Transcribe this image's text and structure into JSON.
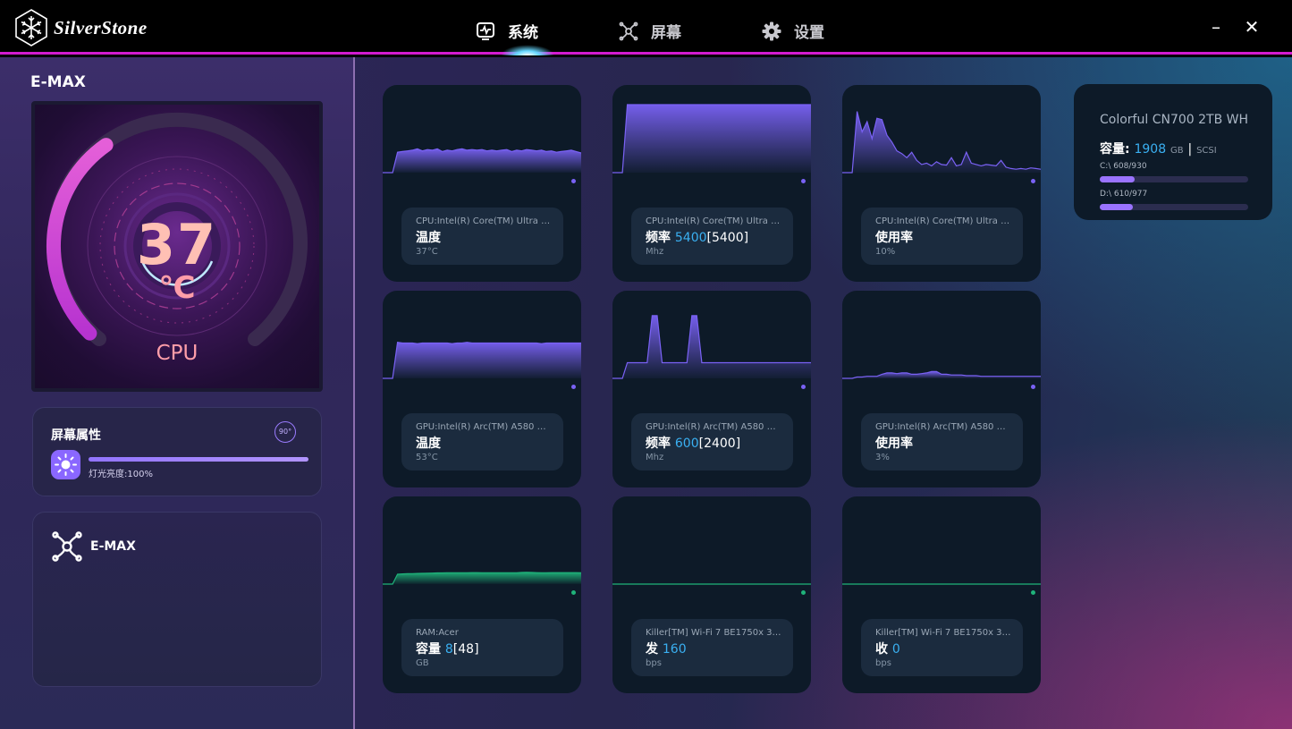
{
  "app": {
    "brand": "SilverStone",
    "nav": [
      {
        "label": "系统",
        "icon": "monitor-heart-icon",
        "active": true
      },
      {
        "label": "屏幕",
        "icon": "fan-icon",
        "active": false
      },
      {
        "label": "设置",
        "icon": "gear-icon",
        "active": false
      }
    ],
    "window_controls": {
      "minimize": "–",
      "close": "✕"
    }
  },
  "left": {
    "section_title": "E-MAX",
    "preview": {
      "temp_value": "37",
      "temp_unit": "℃",
      "label": "CPU",
      "gauge_fraction": 0.37
    },
    "screen_props": {
      "title": "屏幕属性",
      "rotate_label": "90°",
      "brightness_text": "灯光亮度:100%",
      "brightness_value": 1.0
    },
    "device": {
      "name": "E-MAX"
    }
  },
  "cards": [
    {
      "source": "CPU:Intel(R) Core(TM) Ultra 7…",
      "metric": "温度",
      "current": "",
      "max": "",
      "sub": "37°C",
      "series": [
        0,
        0,
        0,
        30,
        31,
        32,
        33,
        35,
        32,
        34,
        33,
        35,
        31,
        33,
        32,
        34,
        35,
        33,
        34,
        33,
        34,
        32,
        33,
        32,
        33,
        34,
        31,
        33,
        32,
        34,
        33,
        32,
        33,
        31,
        32,
        30,
        31,
        32,
        33,
        31,
        29
      ],
      "ymax": 100,
      "color": "purple"
    },
    {
      "source": "CPU:Intel(R) Core(TM) Ultra 7…",
      "metric": "频率",
      "current": "5400",
      "max": "[5400]",
      "sub": "Mhz",
      "series": [
        0,
        0,
        0,
        5400,
        5400,
        5400,
        5400,
        5400,
        5400,
        5400,
        5400,
        5400,
        5400,
        5400,
        5400,
        5400,
        5400,
        5400,
        5400,
        5400,
        5400,
        5400,
        5400,
        5400,
        5400,
        5400,
        5400,
        5400,
        5400,
        5400,
        5400,
        5400,
        5400,
        5400,
        5400,
        5400,
        5400,
        5400,
        5400,
        5400,
        5400
      ],
      "ymax": 5400,
      "color": "purple"
    },
    {
      "source": "CPU:Intel(R) Core(TM) Ultra 7…",
      "metric": "使用率",
      "current": "",
      "max": "",
      "sub": "10%",
      "series": [
        0,
        0,
        0,
        90,
        60,
        75,
        50,
        80,
        78,
        55,
        45,
        32,
        28,
        22,
        30,
        18,
        12,
        14,
        10,
        16,
        12,
        11,
        22,
        10,
        12,
        30,
        14,
        12,
        10,
        12,
        11,
        10,
        18,
        8,
        6,
        5,
        6,
        5,
        7,
        6,
        5
      ],
      "ymax": 100,
      "color": "purple"
    },
    {
      "source": "GPU:Intel(R) Arc(TM) A580 Gra…",
      "metric": "温度",
      "current": "",
      "max": "",
      "sub": "53°C",
      "series": [
        0,
        0,
        0,
        53,
        52,
        52,
        52,
        51,
        52,
        52,
        52,
        52,
        52,
        52,
        51,
        52,
        52,
        53,
        52,
        52,
        52,
        52,
        52,
        52,
        52,
        52,
        52,
        52,
        52,
        52,
        52,
        52,
        51,
        52,
        52,
        52,
        52,
        52,
        52,
        52,
        52
      ],
      "ymax": 100,
      "color": "purple"
    },
    {
      "source": "GPU:Intel(R) Arc(TM) A580 Gra…",
      "metric": "频率",
      "current": "600",
      "max": "[2400]",
      "sub": "Mhz",
      "series": [
        0,
        0,
        0,
        600,
        600,
        600,
        600,
        600,
        2400,
        2400,
        600,
        600,
        600,
        600,
        600,
        600,
        2400,
        2400,
        600,
        600,
        600,
        600,
        600,
        600,
        600,
        600,
        600,
        600,
        600,
        600,
        600,
        600,
        600,
        600,
        600,
        600,
        600,
        600,
        600,
        600,
        600
      ],
      "ymax": 2600,
      "color": "purple"
    },
    {
      "source": "GPU:Intel(R) Arc(TM) A580 Gra…",
      "metric": "使用率",
      "current": "",
      "max": "",
      "sub": "3%",
      "series": [
        0,
        0,
        0,
        2,
        2,
        3,
        3,
        3,
        6,
        8,
        8,
        7,
        8,
        8,
        6,
        6,
        7,
        8,
        10,
        10,
        6,
        6,
        5,
        5,
        5,
        4,
        4,
        4,
        3,
        3,
        3,
        3,
        3,
        3,
        3,
        3,
        3,
        3,
        3,
        3,
        3
      ],
      "ymax": 100,
      "color": "purple"
    },
    {
      "source": "RAM:Acer",
      "metric": "容量",
      "current": "8",
      "max": "[48]",
      "sub": "GB",
      "series": [
        0,
        0,
        0,
        7,
        7.2,
        7.3,
        7.4,
        7.5,
        7.6,
        7.7,
        7.8,
        7.9,
        7.9,
        8,
        8,
        8,
        8,
        8,
        8.1,
        8.1,
        8,
        8,
        8,
        8,
        8,
        8,
        8,
        8,
        8.2,
        8.3,
        8.2,
        8.1,
        8,
        8,
        8.1,
        8.1,
        8.1,
        8.1,
        8.1,
        8.1,
        8
      ],
      "ymax": 48,
      "color": "green"
    },
    {
      "source": "Killer[TM] Wi-Fi 7 BE1750x 320…",
      "metric": "发",
      "current": "160",
      "max": "",
      "sub": "bps",
      "series": [
        0,
        0,
        0,
        0,
        0,
        0,
        0,
        0,
        0,
        0,
        0,
        0,
        0,
        0,
        0,
        0,
        0,
        0,
        0,
        0,
        0,
        0,
        0,
        0,
        0,
        0,
        0,
        0,
        0,
        0,
        0,
        0,
        0,
        0,
        0,
        0,
        0,
        0,
        0,
        0,
        0
      ],
      "ymax": 100000,
      "color": "green"
    },
    {
      "source": "Killer[TM] Wi-Fi 7 BE1750x 320…",
      "metric": "收",
      "current": "0",
      "max": "",
      "sub": "bps",
      "series": [
        0,
        0,
        0,
        0,
        0,
        0,
        0,
        0,
        0,
        0,
        0,
        0,
        0,
        0,
        0,
        0,
        0,
        0,
        0,
        0,
        0,
        0,
        0,
        0,
        0,
        0,
        0,
        0,
        0,
        0,
        0,
        0,
        0,
        0,
        0,
        0,
        0,
        0,
        0,
        0,
        0
      ],
      "ymax": 100000,
      "color": "green"
    }
  ],
  "colors": {
    "purple": "#7a62f5",
    "green": "#1fb37a",
    "accent": "#d21bd0",
    "value_blue": "#3ab0f2"
  },
  "storage": {
    "name": "Colorful CN700 2TB WH",
    "cap_label": "容量:",
    "cap_value": "1908",
    "cap_unit": "GB",
    "sep": "|",
    "interface": "SCSI",
    "volumes": [
      {
        "label": "C:\\ 608/930",
        "used": 608,
        "total": 930
      },
      {
        "label": "D:\\ 610/977",
        "used": 610,
        "total": 977
      }
    ]
  }
}
